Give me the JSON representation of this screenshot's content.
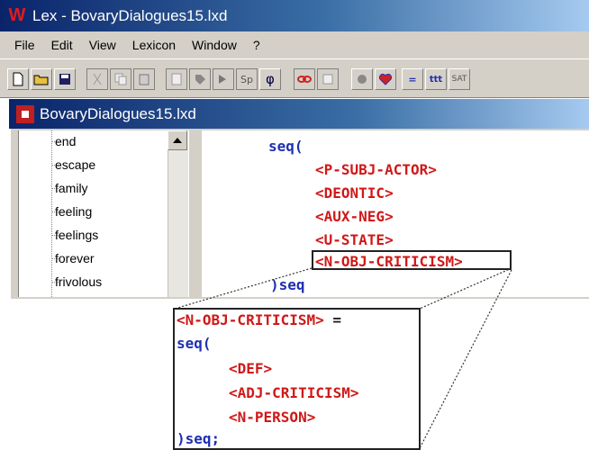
{
  "app": {
    "title": "Lex - BovaryDialogues15.lxd",
    "icon_glyph": "W"
  },
  "menu": [
    "File",
    "Edit",
    "View",
    "Lexicon",
    "Window",
    "?"
  ],
  "toolbar": {
    "buttons": [
      "new-icon",
      "open-icon",
      "save-icon",
      "cut-icon",
      "copy-icon",
      "paste-icon",
      "doc-icon",
      "tag-icon",
      "run-icon",
      "sp-icon",
      "phi-icon",
      "red-link-icon",
      "text-icon",
      "record-icon",
      "heart-icon",
      "equals-icon",
      "bars-icon",
      "sat-icon"
    ],
    "labels": {
      "sp": "Sp",
      "phi": "φ",
      "eq": "=",
      "bars": "ttt",
      "sat": "SAT"
    }
  },
  "document": {
    "title": "BovaryDialogues15.lxd"
  },
  "tree": {
    "items": [
      "end",
      "escape",
      "family",
      "feeling",
      "feelings",
      "forever",
      "frivolous"
    ]
  },
  "editor": {
    "open": "seq(",
    "tokens": [
      "<P-SUBJ-ACTOR>",
      "<DEONTIC>",
      "<AUX-NEG>",
      "<U-STATE>",
      "<N-OBJ-CRITICISM>"
    ],
    "close": ")seq"
  },
  "callout": {
    "head": "<N-OBJ-CRITICISM>",
    "eq": " =",
    "open": "seq(",
    "tokens": [
      "<DEF>",
      "<ADJ-CRITICISM>",
      "<N-PERSON>"
    ],
    "close": ")seq;"
  },
  "colors": {
    "keyword": "#1f2fb0",
    "nonterminal": "#d01818"
  }
}
